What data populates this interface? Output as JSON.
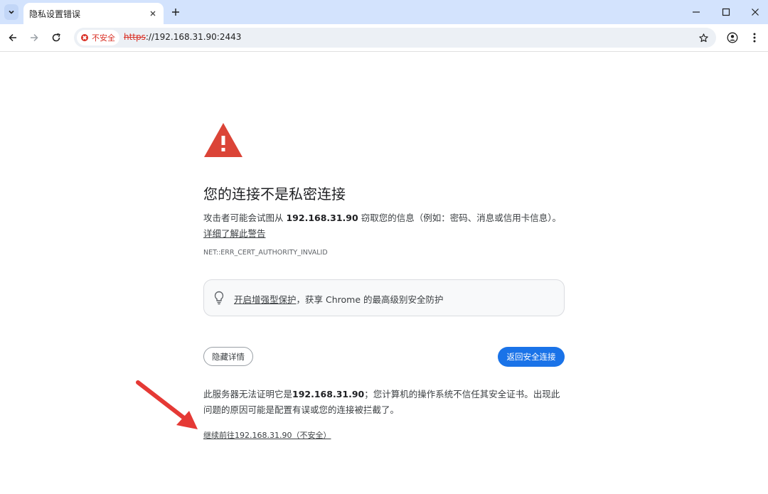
{
  "tab": {
    "title": "隐私设置错误"
  },
  "address_bar": {
    "security_label": "不安全",
    "url_scheme": "https",
    "url_rest": "://192.168.31.90:2443"
  },
  "interstitial": {
    "heading": "您的连接不是私密连接",
    "message_pre": "攻击者可能会试图从 ",
    "message_host": "192.168.31.90",
    "message_post": " 窃取您的信息（例如：密码、消息或信用卡信息）。",
    "learn_more": "详细了解此警告",
    "error_code": "NET::ERR_CERT_AUTHORITY_INVALID",
    "safe_browsing_link": "开启增强型保护",
    "safe_browsing_rest": "，获享 Chrome 的最高级别安全防护",
    "hide_details": "隐藏详情",
    "back_to_safety": "返回安全连接",
    "details_pre": "此服务器无法证明它是",
    "details_host": "192.168.31.90",
    "details_post": "；您计算机的操作系统不信任其安全证书。出现此问题的原因可能是配置有误或您的连接被拦截了。",
    "proceed_link": "继续前往192.168.31.90（不安全）"
  },
  "colors": {
    "tabstrip": "#d3e3fd",
    "danger": "#d93025",
    "primary_button": "#1a73e8",
    "annotation_arrow": "#e53935"
  },
  "icons": {
    "tab_search": "chevron-down-icon",
    "tab_close": "close-icon",
    "new_tab": "plus-icon",
    "back": "arrow-left-icon",
    "forward": "arrow-right-icon",
    "reload": "reload-icon",
    "security": "not-secure-icon",
    "bookmark": "star-icon",
    "profile": "profile-icon",
    "menu": "kebab-menu-icon",
    "warning": "warning-triangle-icon",
    "safe_browsing": "lightbulb-icon"
  }
}
